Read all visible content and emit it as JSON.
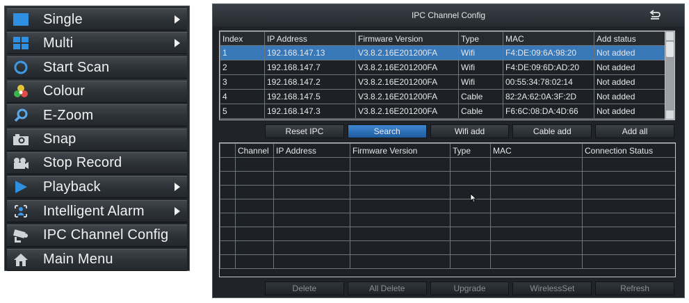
{
  "menu": {
    "items": [
      {
        "label": "Single",
        "icon": "single-view-icon",
        "has_submenu": true
      },
      {
        "label": "Multi",
        "icon": "multi-view-icon",
        "has_submenu": true
      },
      {
        "label": "Start Scan",
        "icon": "scan-icon",
        "has_submenu": false
      },
      {
        "label": "Colour",
        "icon": "colour-icon",
        "has_submenu": false
      },
      {
        "label": "E-Zoom",
        "icon": "magnifier-icon",
        "has_submenu": false
      },
      {
        "label": "Snap",
        "icon": "camera-icon",
        "has_submenu": false
      },
      {
        "label": "Stop Record",
        "icon": "record-icon",
        "has_submenu": false
      },
      {
        "label": "Playback",
        "icon": "play-icon",
        "has_submenu": true
      },
      {
        "label": "Intelligent Alarm",
        "icon": "alarm-icon",
        "has_submenu": true
      },
      {
        "label": "IPC Channel Config",
        "icon": "ip-camera-icon",
        "has_submenu": false
      },
      {
        "label": "Main Menu",
        "icon": "home-icon",
        "has_submenu": false
      }
    ]
  },
  "ipc": {
    "title": "IPC Channel Config",
    "top_headers": [
      "Index",
      "IP Address",
      "Firmware Version",
      "Type",
      "MAC",
      "Add status"
    ],
    "top_rows": [
      [
        "1",
        "192.168.147.13",
        "V3.8.2.16E201200FA",
        "Wifi",
        "F4:DE:09:6A:98:20",
        "Not added"
      ],
      [
        "2",
        "192.168.147.7",
        "V3.8.2.16E201200FA",
        "Wifi",
        "F4:DE:09:6D:AD:20",
        "Not added"
      ],
      [
        "3",
        "192.168.147.2",
        "V3.8.2.16E201200FA",
        "Wifi",
        "00:55:34:78:02:14",
        "Not added"
      ],
      [
        "4",
        "192.168.147.5",
        "V3.8.2.16E201200FA",
        "Cable",
        "82:2A:62:0A:3F:2D",
        "Not added"
      ],
      [
        "5",
        "192.168.147.3",
        "V3.8.2.16E201200FA",
        "Cable",
        "F6:6C:08:DA:4D:66",
        "Not added"
      ]
    ],
    "action_buttons": [
      "Reset IPC",
      "Search",
      "Wifi add",
      "Cable add",
      "Add all"
    ],
    "bottom_headers": [
      "",
      "Channel",
      "IP Address",
      "Firmware Version",
      "Type",
      "MAC",
      "Connection Status"
    ],
    "bottom_buttons": [
      "Delete",
      "All Delete",
      "Upgrade",
      "WirelessSet",
      "Refresh"
    ],
    "colors": {
      "selected_row": "#3878b8",
      "active_button": "#2f74c0",
      "window_bg": "#202429"
    }
  }
}
